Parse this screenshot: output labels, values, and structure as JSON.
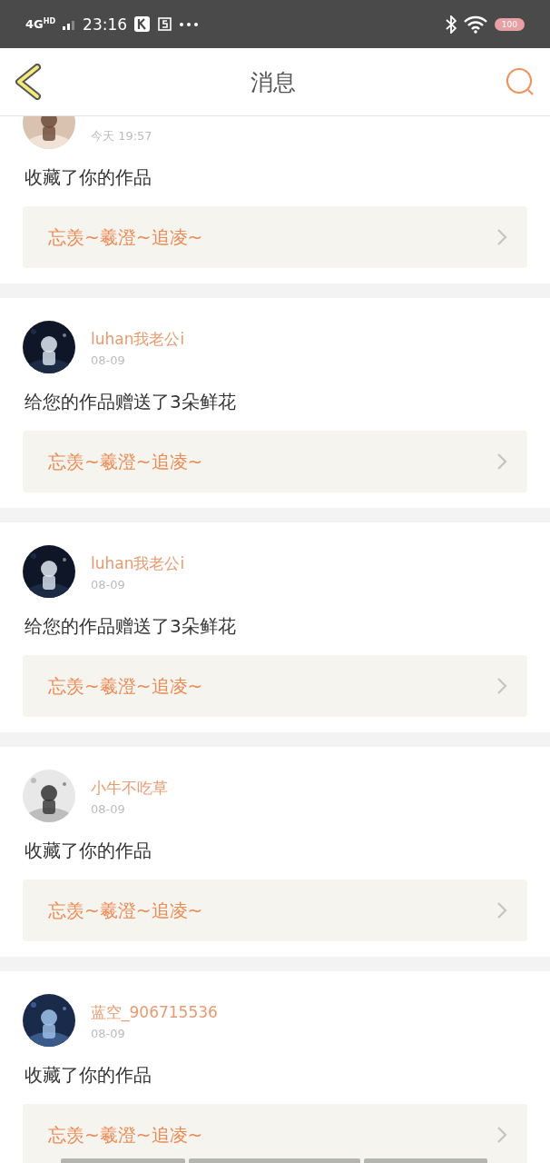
{
  "status_bar": {
    "network": "4G",
    "network_badge": "HD",
    "time": "23:16",
    "battery": "100"
  },
  "header": {
    "title": "消息"
  },
  "messages": [
    {
      "date": "今天 19:57",
      "text": "收藏了你的作品",
      "work": "忘羡~羲澄~追凌~"
    },
    {
      "name": "luhan我老公i",
      "date": "08-09",
      "text": "给您的作品赠送了3朵鲜花",
      "work": "忘羡~羲澄~追凌~"
    },
    {
      "name": "luhan我老公i",
      "date": "08-09",
      "text": "给您的作品赠送了3朵鲜花",
      "work": "忘羡~羲澄~追凌~"
    },
    {
      "name": "小牛不吃草",
      "date": "08-09",
      "text": "收藏了你的作品",
      "work": "忘羡~羲澄~追凌~"
    },
    {
      "name": "蓝空_906715536",
      "date": "08-09",
      "text": "收藏了你的作品",
      "work": "忘羡~羲澄~追凌~"
    }
  ]
}
